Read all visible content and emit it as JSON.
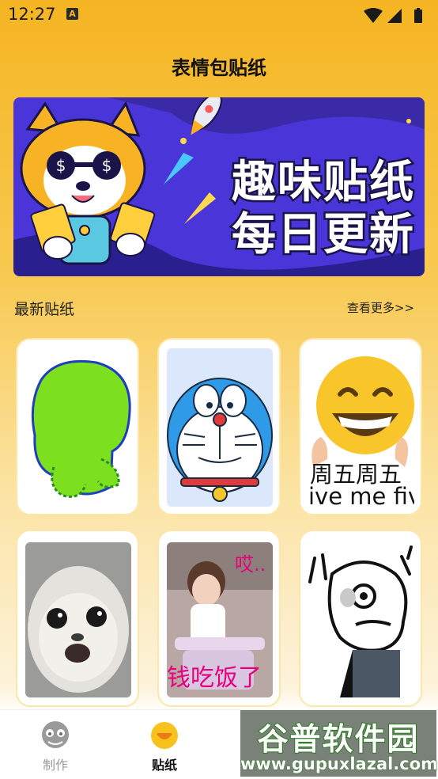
{
  "status_bar": {
    "time": "12:27",
    "notification_badge": "A",
    "icons": [
      "wifi-icon",
      "signal-icon",
      "battery-icon"
    ]
  },
  "header": {
    "title": "表情包贴纸"
  },
  "banner": {
    "line1": "趣味贴纸",
    "line2": "每日更新"
  },
  "section": {
    "title": "最新贴纸",
    "more_label": "查看更多>>"
  },
  "stickers": [
    {
      "name": "green-blob-sticker",
      "caption_1": "",
      "caption_2": ""
    },
    {
      "name": "doraemon-sticker",
      "caption_1": "",
      "caption_2": ""
    },
    {
      "name": "grin-emoji-sticker",
      "caption_1": "周五周五",
      "caption_2": "ive me fiv"
    },
    {
      "name": "seal-sticker",
      "caption_1": "",
      "caption_2": ""
    },
    {
      "name": "baby-sticker",
      "caption_1": "哎..",
      "caption_2": "钱吃饭了"
    },
    {
      "name": "sketch-dog-sticker",
      "caption_1": "",
      "caption_2": ""
    }
  ],
  "tabs": [
    {
      "label": "制作",
      "icon": "skull-icon",
      "active": false
    },
    {
      "label": "贴纸",
      "icon": "smile-face-icon",
      "active": true
    }
  ],
  "watermark": {
    "title": "谷普软件园",
    "url": "www.gupuxlazal.com"
  },
  "colors": {
    "primary_yellow": "#f5b523",
    "active_tab": "#111111",
    "inactive_tab": "#9a9a9a",
    "banner_purple": "#4a35d8"
  }
}
